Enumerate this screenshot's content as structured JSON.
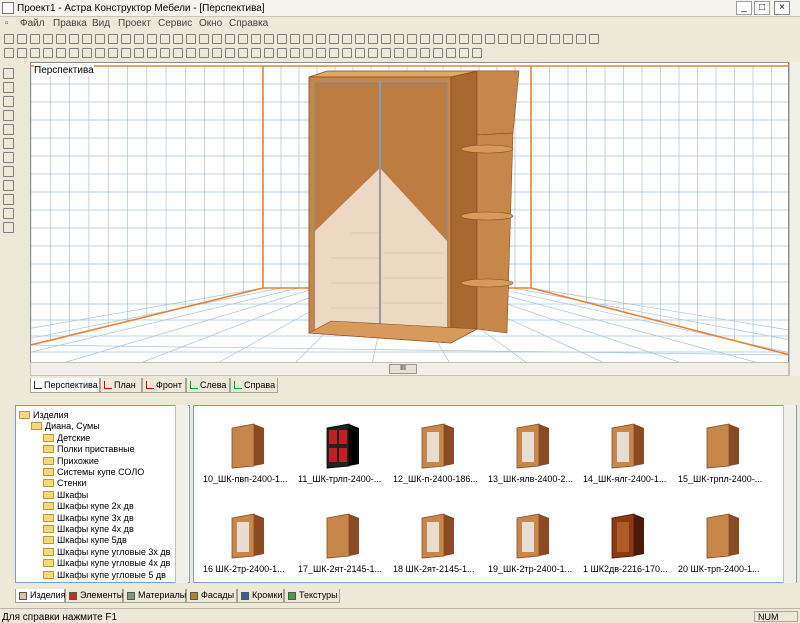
{
  "window": {
    "title": "Проект1 - Астра Конструктор Мебели - [Перспектива]",
    "minimize": "_",
    "restore": "□",
    "close": "×"
  },
  "menu": [
    "Файл",
    "Правка",
    "Вид",
    "Проект",
    "Сервис",
    "Окно",
    "Справка"
  ],
  "viewport": {
    "label": "Перспектива",
    "scroll_thumb": "III"
  },
  "view_tabs": [
    "Перспектива",
    "План",
    "Фронт",
    "Слева",
    "Справа"
  ],
  "tree": [
    {
      "label": "Изделия",
      "level": 0
    },
    {
      "label": "Диана, Сумы",
      "level": 1
    },
    {
      "label": "Детские",
      "level": 2
    },
    {
      "label": "Полки приставные",
      "level": 2
    },
    {
      "label": "Прихожие",
      "level": 2
    },
    {
      "label": "Системы купе СОЛО",
      "level": 2
    },
    {
      "label": "Стенки",
      "level": 2
    },
    {
      "label": "Шкафы",
      "level": 2
    },
    {
      "label": "Шкафы купе 2х дв",
      "level": 2
    },
    {
      "label": "Шкафы купе 3х дв",
      "level": 2
    },
    {
      "label": "Шкафы купе 4х дв",
      "level": 2
    },
    {
      "label": "Шкафы купе 5дв",
      "level": 2
    },
    {
      "label": "Шкафы купе угловые 3х дв",
      "level": 2
    },
    {
      "label": "Шкафы купе угловые 4х дв",
      "level": 2
    },
    {
      "label": "Шкафы купе угловые 5 дв",
      "level": 2
    }
  ],
  "items": [
    {
      "label": "10_ШК-пвп-2400-1...",
      "style": "wood"
    },
    {
      "label": "11_ШК-трлп-2400-...",
      "style": "dark"
    },
    {
      "label": "12_ШК-п-2400-186...",
      "style": "mirror"
    },
    {
      "label": "13_ШК-ялв-2400-2...",
      "style": "mirror"
    },
    {
      "label": "14_ШК-ялг-2400-1...",
      "style": "mirror"
    },
    {
      "label": "15_ШК-трпл-2400-...",
      "style": "wood"
    },
    {
      "label": "16 ШК-2тр-2400-1...",
      "style": "mirror"
    },
    {
      "label": "17_ШК-2ят-2145-1...",
      "style": "wood"
    },
    {
      "label": "18 ШК-2ят-2145-1...",
      "style": "mirror"
    },
    {
      "label": "19_ШК-2тр-2400-1...",
      "style": "mirror"
    },
    {
      "label": "1 ШК2дв-2216-170...",
      "style": "darkwood"
    },
    {
      "label": "20 ШК-трп-2400-1...",
      "style": "wood"
    }
  ],
  "bottom_tabs": [
    "Изделия",
    "Элементы",
    "Материалы",
    "Фасады",
    "Кромки",
    "Текстуры"
  ],
  "status": {
    "text": "Для справки нажмите F1",
    "num": "NUM"
  },
  "colors": {
    "wood": "#c8874a",
    "wood_light": "#e0a86a",
    "wood_dark": "#8a4a22",
    "mirror": "#f2e2d2",
    "room_edge": "#e8823a",
    "grid": "#a8c4d8"
  }
}
